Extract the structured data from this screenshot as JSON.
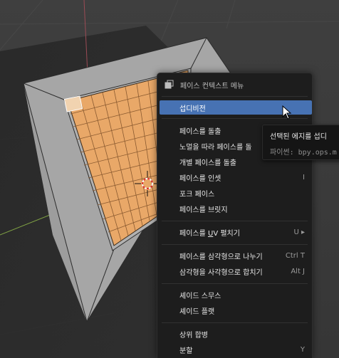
{
  "menu": {
    "title": "페이스 컨텍스트 메뉴",
    "items": [
      {
        "label": "섭디비전",
        "shortcut": ""
      },
      {
        "label": "페이스를 돌출",
        "shortcut": ""
      },
      {
        "label": "노멀을 따라 페이스를 돌",
        "shortcut": ""
      },
      {
        "label": "개별 페이스를 돌출",
        "shortcut": ""
      },
      {
        "label": "페이스를 인셋",
        "shortcut": "I"
      },
      {
        "label": "포크 페이스",
        "shortcut": ""
      },
      {
        "label": "페이스를 브릿지",
        "shortcut": ""
      },
      {
        "label_pre": "페이스를 ",
        "label_u": "U",
        "label_post": "V 펼치기",
        "shortcut": "U ▸"
      },
      {
        "label": "페이스를 삼각형으로 나누기",
        "shortcut": "Ctrl T"
      },
      {
        "label": "삼각형을 사각형으로 합치기",
        "shortcut": "Alt J"
      },
      {
        "label": "셰이드 스무스",
        "shortcut": ""
      },
      {
        "label": "셰이드 플랫",
        "shortcut": ""
      },
      {
        "label": "상위 합병",
        "shortcut": ""
      },
      {
        "label": "분할",
        "shortcut": "Y"
      }
    ]
  },
  "tooltip": {
    "description": "선택된 에지를 섭디",
    "python": "파이썬: bpy.ops.m"
  },
  "colors": {
    "viewport_bg": "#3a3a3a",
    "face_selected": "#e9a868",
    "menu_bg": "#1d1d1d",
    "highlight": "#4772b3"
  }
}
